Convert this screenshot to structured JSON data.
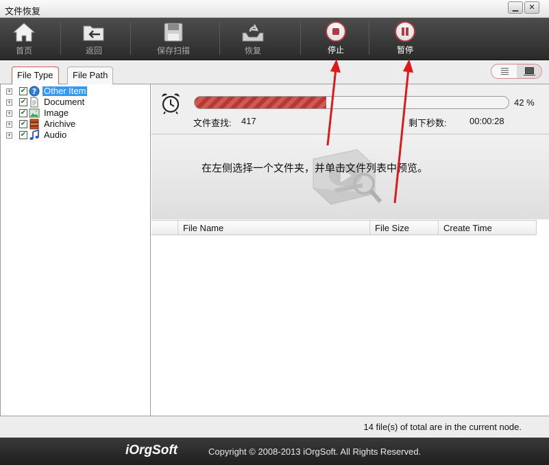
{
  "window": {
    "title": "文件恢复",
    "min_label": "▁",
    "close_label": "✕"
  },
  "toolbar": {
    "home_label": "首页",
    "back_label": "返回",
    "save_scan_label": "保存扫描",
    "recover_label": "恢复",
    "stop_label": "停止",
    "pause_label": "暂停"
  },
  "tabs": {
    "file_type": "File Type",
    "file_path": "File Path"
  },
  "tree": {
    "items": [
      {
        "label": "Other Item",
        "icon": "question-icon",
        "selected": true
      },
      {
        "label": "Document",
        "icon": "document-icon",
        "selected": false
      },
      {
        "label": "Image",
        "icon": "image-icon",
        "selected": false
      },
      {
        "label": "Arichive",
        "icon": "archive-icon",
        "selected": false
      },
      {
        "label": "Audio",
        "icon": "music-note-icon",
        "selected": false
      }
    ]
  },
  "scan": {
    "progress_percent": 42,
    "progress_text": "42 %",
    "files_found_label": "文件查找:",
    "files_found_value": "417",
    "remaining_label": "剩下秒数:",
    "remaining_value": "00:00:28"
  },
  "preview": {
    "message": "在左侧选择一个文件夹，并单击文件列表中预览。"
  },
  "table": {
    "columns": [
      "File Name",
      "File Size",
      "Create Time"
    ]
  },
  "status": {
    "text": "14 file(s) of total are in the current node."
  },
  "footer": {
    "brand": "iOrgSoft",
    "copyright": "Copyright © 2008-2013 iOrgSoft. All Rights Reserved."
  },
  "colors": {
    "accent": "#d85a60",
    "progress_fill": "#b8383a",
    "selection": "#3399ff",
    "annotation_arrow": "#e01818"
  }
}
